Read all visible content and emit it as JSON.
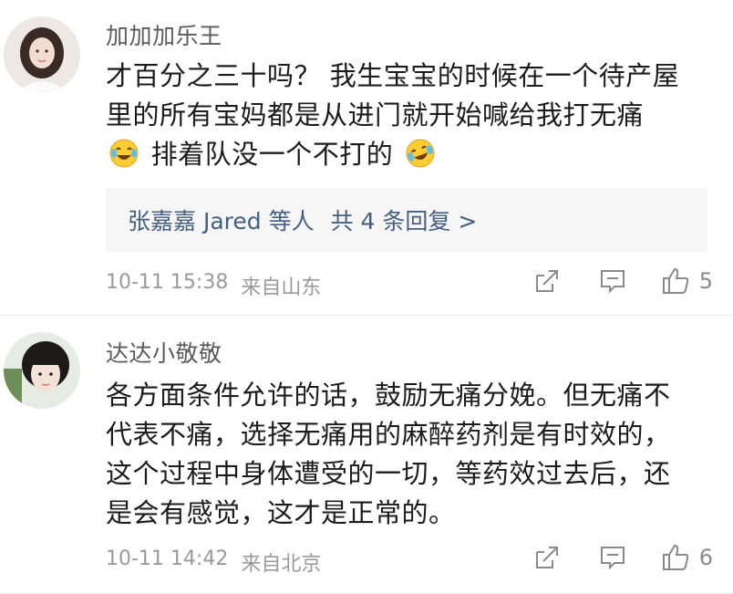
{
  "comments": [
    {
      "username": "加加加乐王",
      "text_line1": "才百分之三十吗？ 我生宝宝的时候在一个待产屋",
      "text_line2": "里的所有宝妈都是从进门就开始喊给我打无痛",
      "text_line3": "排着队没一个不打的",
      "replies_names": "张嘉嘉 Jared 等人",
      "replies_count": "共 4 条回复 >",
      "time": "10-11 15:38",
      "location": "来自山东",
      "likes": "5",
      "emoji": "laughing-crying-icon"
    },
    {
      "username": "达达小敬敬",
      "text_line1": "各方面条件允许的话，鼓励无痛分娩。但无痛不",
      "text_line2": "代表不痛，选择无痛用的麻醉药剂是有时效的，",
      "text_line3": "这个过程中身体遭受的一切，等药效过去后，还",
      "text_line4": "是会有感觉，这才是正常的。",
      "time": "10-11 14:42",
      "location": "来自北京",
      "likes": "6"
    }
  ],
  "colors": {
    "link": "#44607e",
    "meta": "#9a9a9a",
    "reply_bg": "#f6f6f7"
  }
}
